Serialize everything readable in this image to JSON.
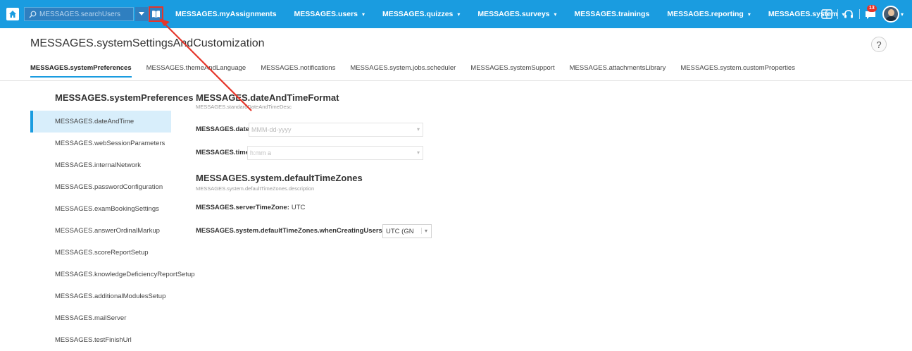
{
  "topbar": {
    "search_placeholder": "MESSAGES.searchUsers",
    "nav": [
      {
        "label": "MESSAGES.myAssignments",
        "caret": false
      },
      {
        "label": "MESSAGES.users",
        "caret": true
      },
      {
        "label": "MESSAGES.quizzes",
        "caret": true
      },
      {
        "label": "MESSAGES.surveys",
        "caret": true
      },
      {
        "label": "MESSAGES.trainings",
        "caret": false
      },
      {
        "label": "MESSAGES.reporting",
        "caret": true
      },
      {
        "label": "MESSAGES.system",
        "caret": true
      }
    ],
    "notification_count": "13",
    "icons": {
      "home": "home-icon",
      "search": "search-icon",
      "book": "book-icon",
      "manual": "manual-icon",
      "headset": "headset-icon",
      "chat": "chat-icon"
    }
  },
  "page": {
    "title": "MESSAGES.systemSettingsAndCustomization",
    "help": "?"
  },
  "tabs": [
    {
      "label": "MESSAGES.systemPreferences",
      "active": true
    },
    {
      "label": "MESSAGES.themeAndLanguage",
      "active": false
    },
    {
      "label": "MESSAGES.notifications",
      "active": false
    },
    {
      "label": "MESSAGES.system.jobs.scheduler",
      "active": false
    },
    {
      "label": "MESSAGES.systemSupport",
      "active": false
    },
    {
      "label": "MESSAGES.attachmentsLibrary",
      "active": false
    },
    {
      "label": "MESSAGES.system.customProperties",
      "active": false
    }
  ],
  "sidebar": {
    "title": "MESSAGES.systemPreferences",
    "items": [
      {
        "label": "MESSAGES.dateAndTime",
        "active": true
      },
      {
        "label": "MESSAGES.webSessionParameters",
        "active": false
      },
      {
        "label": "MESSAGES.internalNetwork",
        "active": false
      },
      {
        "label": "MESSAGES.passwordConfiguration",
        "active": false
      },
      {
        "label": "MESSAGES.examBookingSettings",
        "active": false
      },
      {
        "label": "MESSAGES.answerOrdinalMarkup",
        "active": false
      },
      {
        "label": "MESSAGES.scoreReportSetup",
        "active": false
      },
      {
        "label": "MESSAGES.knowledgeDeficiencyReportSetup",
        "active": false
      },
      {
        "label": "MESSAGES.additionalModulesSetup",
        "active": false
      },
      {
        "label": "MESSAGES.mailServer",
        "active": false
      },
      {
        "label": "MESSAGES.testFinishUrl",
        "active": false
      }
    ]
  },
  "main": {
    "date_time_section": {
      "title": "MESSAGES.dateAndTimeFormat",
      "description": "MESSAGES.standardDateAndTimeDesc",
      "date_format_label": "MESSAGES.dateFormat:",
      "date_format_placeholder": "MMM-dd-yyyy",
      "time_format_label": "MESSAGES.timeFormat:",
      "time_format_placeholder": "h:mm a"
    },
    "timezone_section": {
      "title": "MESSAGES.system.defaultTimeZones",
      "description": "MESSAGES.system.defaultTimeZones.description",
      "server_tz_label": "MESSAGES.serverTimeZone:",
      "server_tz_value": "UTC",
      "creating_users_label": "MESSAGES.system.defaultTimeZones.whenCreatingUsers:",
      "creating_users_value": "UTC (GN"
    }
  },
  "colors": {
    "topbar": "#1a9ce0",
    "accent": "#1a9ce0",
    "annotation": "#e5352a",
    "active_item_bg": "#d8eefb"
  }
}
